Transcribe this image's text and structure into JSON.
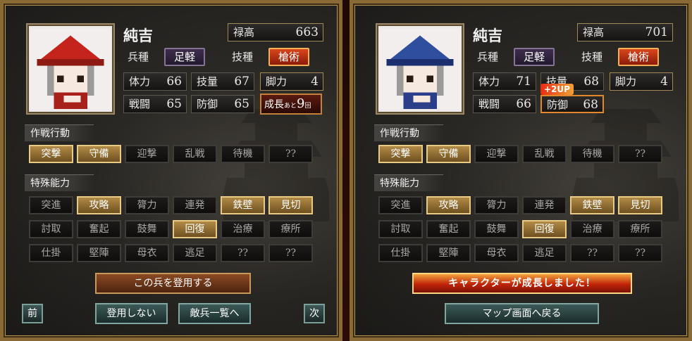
{
  "left": {
    "name": "純吉",
    "salary_label": "禄高",
    "salary_value": "663",
    "unit_label": "兵種",
    "unit_value": "足軽",
    "skill_label": "技種",
    "skill_value": "槍術",
    "stats": {
      "hp": {
        "label": "体力",
        "value": "66"
      },
      "tech": {
        "label": "技量",
        "value": "67"
      },
      "legs": {
        "label": "脚力",
        "value": "4"
      },
      "battle": {
        "label": "戦闘",
        "value": "65"
      },
      "defense": {
        "label": "防御",
        "value": "65"
      }
    },
    "growth": {
      "prefix": "成長",
      "small": "あと",
      "value": "9",
      "suffix": "回"
    },
    "tactics_title": "作戦行動",
    "tactics": [
      {
        "label": "突撃",
        "on": true
      },
      {
        "label": "守備",
        "on": true
      },
      {
        "label": "迎撃",
        "on": false
      },
      {
        "label": "乱戦",
        "on": false
      },
      {
        "label": "待機",
        "on": false
      },
      {
        "label": "??",
        "on": false
      }
    ],
    "special_title": "特殊能力",
    "special": [
      [
        {
          "label": "突進",
          "on": false
        },
        {
          "label": "攻略",
          "on": true
        },
        {
          "label": "膂力",
          "on": false
        },
        {
          "label": "連発",
          "on": false
        },
        {
          "label": "鉄壁",
          "on": true
        },
        {
          "label": "見切",
          "on": true
        }
      ],
      [
        {
          "label": "討取",
          "on": false
        },
        {
          "label": "奮起",
          "on": false
        },
        {
          "label": "鼓舞",
          "on": false
        },
        {
          "label": "回復",
          "on": true
        },
        {
          "label": "治療",
          "on": false
        },
        {
          "label": "療所",
          "on": false
        }
      ],
      [
        {
          "label": "仕掛",
          "on": false
        },
        {
          "label": "堅陣",
          "on": false
        },
        {
          "label": "母衣",
          "on": false
        },
        {
          "label": "逃足",
          "on": false
        },
        {
          "label": "??",
          "on": false
        },
        {
          "label": "??",
          "on": false
        }
      ]
    ],
    "recruit_button": "この兵を登用する",
    "no_recruit_button": "登用しない",
    "enemy_list_button": "敵兵一覧へ",
    "prev_button": "前",
    "next_button": "次"
  },
  "right": {
    "name": "純吉",
    "salary_label": "禄高",
    "salary_value": "701",
    "unit_label": "兵種",
    "unit_value": "足軽",
    "skill_label": "技種",
    "skill_value": "槍術",
    "stats": {
      "hp": {
        "label": "体力",
        "value": "71"
      },
      "tech": {
        "label": "技量",
        "value": "68"
      },
      "legs": {
        "label": "脚力",
        "value": "4"
      },
      "battle": {
        "label": "戦闘",
        "value": "66"
      },
      "defense": {
        "label": "防御",
        "value": "68"
      }
    },
    "up_badge": "+2UP",
    "tactics_title": "作戦行動",
    "tactics": [
      {
        "label": "突撃",
        "on": true
      },
      {
        "label": "守備",
        "on": true
      },
      {
        "label": "迎撃",
        "on": false
      },
      {
        "label": "乱戦",
        "on": false
      },
      {
        "label": "待機",
        "on": false
      },
      {
        "label": "??",
        "on": false
      }
    ],
    "special_title": "特殊能力",
    "special": [
      [
        {
          "label": "突進",
          "on": false
        },
        {
          "label": "攻略",
          "on": true
        },
        {
          "label": "膂力",
          "on": false
        },
        {
          "label": "連発",
          "on": false
        },
        {
          "label": "鉄壁",
          "on": true
        },
        {
          "label": "見切",
          "on": true
        }
      ],
      [
        {
          "label": "討取",
          "on": false
        },
        {
          "label": "奮起",
          "on": false
        },
        {
          "label": "鼓舞",
          "on": false
        },
        {
          "label": "回復",
          "on": true
        },
        {
          "label": "治療",
          "on": false
        },
        {
          "label": "療所",
          "on": false
        }
      ],
      [
        {
          "label": "仕掛",
          "on": false
        },
        {
          "label": "堅陣",
          "on": false
        },
        {
          "label": "母衣",
          "on": false
        },
        {
          "label": "逃足",
          "on": false
        },
        {
          "label": "??",
          "on": false
        },
        {
          "label": "??",
          "on": false
        }
      ]
    ],
    "grown_banner": "キャラクターが成長しました！",
    "back_button": "マップ画面へ戻る"
  },
  "colors": {
    "hat_left": "#c4241c",
    "hat_right": "#2f4e9e",
    "accent_gold": "#b08a46",
    "frame": "#8a6a34"
  }
}
